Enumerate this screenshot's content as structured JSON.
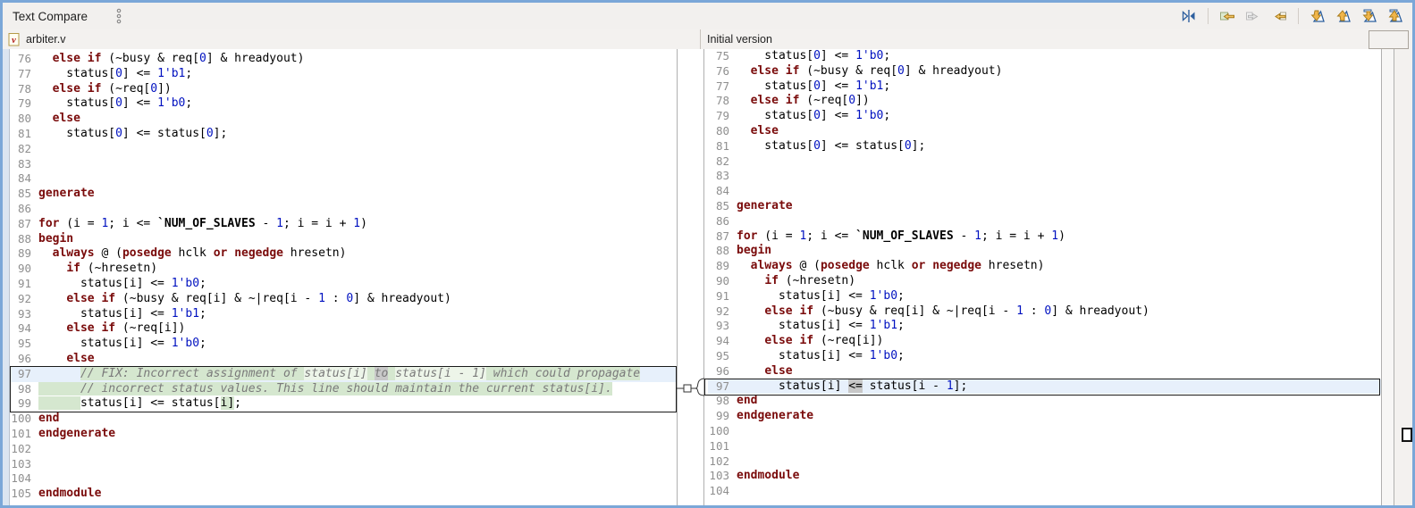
{
  "titlebar": {
    "title": "Text Compare"
  },
  "toolbar": {
    "icons": [
      {
        "name": "swap-left-right-icon"
      },
      {
        "name": "copy-all-right-to-left-icon"
      },
      {
        "name": "copy-left-to-right-icon-disabled"
      },
      {
        "name": "copy-right-to-left-icon"
      },
      {
        "name": "next-difference-icon"
      },
      {
        "name": "previous-difference-icon"
      },
      {
        "name": "next-change-icon"
      },
      {
        "name": "previous-change-icon"
      }
    ]
  },
  "colors": {
    "frame_blue": "#7ba7d8",
    "diff_added_green": "#d5e7cf",
    "selected_line_blue": "#e7f0fb",
    "token_diff_gray": "#c8c8c8",
    "keyword_maroon": "#7a0b0b",
    "literal_blue": "#0011c0"
  },
  "left_pane": {
    "file_name": "arbiter.v",
    "lines": [
      {
        "n": 76,
        "seg": [
          [
            "p",
            "  "
          ],
          [
            "k",
            "else"
          ],
          [
            "p",
            " "
          ],
          [
            "k",
            "if"
          ],
          [
            "p",
            " (~busy & req["
          ],
          [
            "n",
            "0"
          ],
          [
            "p",
            "] & hreadyout)"
          ]
        ]
      },
      {
        "n": 77,
        "seg": [
          [
            "p",
            "    status["
          ],
          [
            "n",
            "0"
          ],
          [
            "p",
            "] <= "
          ],
          [
            "n",
            "1'b1"
          ],
          [
            "p",
            ";"
          ]
        ]
      },
      {
        "n": 78,
        "seg": [
          [
            "p",
            "  "
          ],
          [
            "k",
            "else"
          ],
          [
            "p",
            " "
          ],
          [
            "k",
            "if"
          ],
          [
            "p",
            " (~req["
          ],
          [
            "n",
            "0"
          ],
          [
            "p",
            "])"
          ]
        ]
      },
      {
        "n": 79,
        "seg": [
          [
            "p",
            "    status["
          ],
          [
            "n",
            "0"
          ],
          [
            "p",
            "] <= "
          ],
          [
            "n",
            "1'b0"
          ],
          [
            "p",
            ";"
          ]
        ]
      },
      {
        "n": 80,
        "seg": [
          [
            "p",
            "  "
          ],
          [
            "k",
            "else"
          ]
        ]
      },
      {
        "n": 81,
        "seg": [
          [
            "p",
            "    status["
          ],
          [
            "n",
            "0"
          ],
          [
            "p",
            "] <= status["
          ],
          [
            "n",
            "0"
          ],
          [
            "p",
            "];"
          ]
        ]
      },
      {
        "n": 82,
        "seg": []
      },
      {
        "n": 83,
        "seg": []
      },
      {
        "n": 84,
        "seg": []
      },
      {
        "n": 85,
        "seg": [
          [
            "k",
            "generate"
          ]
        ]
      },
      {
        "n": 86,
        "seg": []
      },
      {
        "n": 87,
        "seg": [
          [
            "k",
            "for"
          ],
          [
            "p",
            " (i = "
          ],
          [
            "n",
            "1"
          ],
          [
            "p",
            "; i <= "
          ],
          [
            "m",
            "`NUM_OF_SLAVES"
          ],
          [
            "p",
            " - "
          ],
          [
            "n",
            "1"
          ],
          [
            "p",
            "; i = i + "
          ],
          [
            "n",
            "1"
          ],
          [
            "p",
            ")"
          ]
        ]
      },
      {
        "n": 88,
        "seg": [
          [
            "k",
            "begin"
          ]
        ]
      },
      {
        "n": 89,
        "seg": [
          [
            "p",
            "  "
          ],
          [
            "k",
            "always"
          ],
          [
            "p",
            " @ ("
          ],
          [
            "k",
            "posedge"
          ],
          [
            "p",
            " hclk "
          ],
          [
            "k",
            "or"
          ],
          [
            "p",
            " "
          ],
          [
            "k",
            "negedge"
          ],
          [
            "p",
            " hresetn)"
          ]
        ]
      },
      {
        "n": 90,
        "seg": [
          [
            "p",
            "    "
          ],
          [
            "k",
            "if"
          ],
          [
            "p",
            " (~hresetn)"
          ]
        ]
      },
      {
        "n": 91,
        "seg": [
          [
            "p",
            "      status[i] <= "
          ],
          [
            "n",
            "1'b0"
          ],
          [
            "p",
            ";"
          ]
        ]
      },
      {
        "n": 92,
        "seg": [
          [
            "p",
            "    "
          ],
          [
            "k",
            "else"
          ],
          [
            "p",
            " "
          ],
          [
            "k",
            "if"
          ],
          [
            "p",
            " (~busy & req[i] & ~|req[i - "
          ],
          [
            "n",
            "1"
          ],
          [
            "p",
            " : "
          ],
          [
            "n",
            "0"
          ],
          [
            "p",
            "] & hreadyout)"
          ]
        ]
      },
      {
        "n": 93,
        "seg": [
          [
            "p",
            "      status[i] <= "
          ],
          [
            "n",
            "1'b1"
          ],
          [
            "p",
            ";"
          ]
        ]
      },
      {
        "n": 94,
        "seg": [
          [
            "p",
            "    "
          ],
          [
            "k",
            "else"
          ],
          [
            "p",
            " "
          ],
          [
            "k",
            "if"
          ],
          [
            "p",
            " (~req[i])"
          ]
        ]
      },
      {
        "n": 95,
        "seg": [
          [
            "p",
            "      status[i] <= "
          ],
          [
            "n",
            "1'b0"
          ],
          [
            "p",
            ";"
          ]
        ]
      },
      {
        "n": 96,
        "seg": [
          [
            "p",
            "    "
          ],
          [
            "k",
            "else"
          ]
        ]
      },
      {
        "n": 97,
        "row": "blue",
        "seg": [
          [
            "p",
            "      "
          ],
          [
            "c",
            "// FIX: Incorrect assignment of ",
            "g"
          ],
          [
            "c",
            "status[i]",
            "gl"
          ],
          [
            "c",
            " ",
            "g"
          ],
          [
            "c",
            "to",
            "gy"
          ],
          [
            "c",
            " ",
            "g"
          ],
          [
            "c",
            "status[i - 1]",
            "gl"
          ],
          [
            "c",
            " which could propagate",
            "g"
          ]
        ]
      },
      {
        "n": 98,
        "seg": [
          [
            "p",
            "      ",
            "g"
          ],
          [
            "c",
            "// incorrect status values. This line should maintain the current status[i].",
            "g"
          ]
        ]
      },
      {
        "n": 99,
        "seg": [
          [
            "p",
            "      ",
            "g"
          ],
          [
            "p",
            "status[i] <= status["
          ],
          [
            "p",
            "i]",
            "g"
          ],
          [
            "p",
            ";"
          ]
        ]
      },
      {
        "n": 100,
        "seg": [
          [
            "k",
            "end"
          ]
        ]
      },
      {
        "n": 101,
        "seg": [
          [
            "k",
            "endgenerate"
          ]
        ]
      },
      {
        "n": 102,
        "seg": []
      },
      {
        "n": 103,
        "seg": []
      },
      {
        "n": 104,
        "seg": []
      },
      {
        "n": 105,
        "seg": [
          [
            "k",
            "endmodule"
          ]
        ]
      }
    ]
  },
  "right_pane": {
    "title": "Initial version",
    "lines": [
      {
        "n": 75,
        "seg": [
          [
            "p",
            "    status["
          ],
          [
            "n",
            "0"
          ],
          [
            "p",
            "] <= "
          ],
          [
            "n",
            "1'b0"
          ],
          [
            "p",
            ";"
          ]
        ]
      },
      {
        "n": 76,
        "seg": [
          [
            "p",
            "  "
          ],
          [
            "k",
            "else"
          ],
          [
            "p",
            " "
          ],
          [
            "k",
            "if"
          ],
          [
            "p",
            " (~busy & req["
          ],
          [
            "n",
            "0"
          ],
          [
            "p",
            "] & hreadyout)"
          ]
        ]
      },
      {
        "n": 77,
        "seg": [
          [
            "p",
            "    status["
          ],
          [
            "n",
            "0"
          ],
          [
            "p",
            "] <= "
          ],
          [
            "n",
            "1'b1"
          ],
          [
            "p",
            ";"
          ]
        ]
      },
      {
        "n": 78,
        "seg": [
          [
            "p",
            "  "
          ],
          [
            "k",
            "else"
          ],
          [
            "p",
            " "
          ],
          [
            "k",
            "if"
          ],
          [
            "p",
            " (~req["
          ],
          [
            "n",
            "0"
          ],
          [
            "p",
            "])"
          ]
        ]
      },
      {
        "n": 79,
        "seg": [
          [
            "p",
            "    status["
          ],
          [
            "n",
            "0"
          ],
          [
            "p",
            "] <= "
          ],
          [
            "n",
            "1'b0"
          ],
          [
            "p",
            ";"
          ]
        ]
      },
      {
        "n": 80,
        "seg": [
          [
            "p",
            "  "
          ],
          [
            "k",
            "else"
          ]
        ]
      },
      {
        "n": 81,
        "seg": [
          [
            "p",
            "    status["
          ],
          [
            "n",
            "0"
          ],
          [
            "p",
            "] <= status["
          ],
          [
            "n",
            "0"
          ],
          [
            "p",
            "];"
          ]
        ]
      },
      {
        "n": 82,
        "seg": []
      },
      {
        "n": 83,
        "seg": []
      },
      {
        "n": 84,
        "seg": []
      },
      {
        "n": 85,
        "seg": [
          [
            "k",
            "generate"
          ]
        ]
      },
      {
        "n": 86,
        "seg": []
      },
      {
        "n": 87,
        "seg": [
          [
            "k",
            "for"
          ],
          [
            "p",
            " (i = "
          ],
          [
            "n",
            "1"
          ],
          [
            "p",
            "; i <= "
          ],
          [
            "m",
            "`NUM_OF_SLAVES"
          ],
          [
            "p",
            " - "
          ],
          [
            "n",
            "1"
          ],
          [
            "p",
            "; i = i + "
          ],
          [
            "n",
            "1"
          ],
          [
            "p",
            ")"
          ]
        ]
      },
      {
        "n": 88,
        "seg": [
          [
            "k",
            "begin"
          ]
        ]
      },
      {
        "n": 89,
        "seg": [
          [
            "p",
            "  "
          ],
          [
            "k",
            "always"
          ],
          [
            "p",
            " @ ("
          ],
          [
            "k",
            "posedge"
          ],
          [
            "p",
            " hclk "
          ],
          [
            "k",
            "or"
          ],
          [
            "p",
            " "
          ],
          [
            "k",
            "negedge"
          ],
          [
            "p",
            " hresetn)"
          ]
        ]
      },
      {
        "n": 90,
        "seg": [
          [
            "p",
            "    "
          ],
          [
            "k",
            "if"
          ],
          [
            "p",
            " (~hresetn)"
          ]
        ]
      },
      {
        "n": 91,
        "seg": [
          [
            "p",
            "      status[i] <= "
          ],
          [
            "n",
            "1'b0"
          ],
          [
            "p",
            ";"
          ]
        ]
      },
      {
        "n": 92,
        "seg": [
          [
            "p",
            "    "
          ],
          [
            "k",
            "else"
          ],
          [
            "p",
            " "
          ],
          [
            "k",
            "if"
          ],
          [
            "p",
            " (~busy & req[i] & ~|req[i - "
          ],
          [
            "n",
            "1"
          ],
          [
            "p",
            " : "
          ],
          [
            "n",
            "0"
          ],
          [
            "p",
            "] & hreadyout)"
          ]
        ]
      },
      {
        "n": 93,
        "seg": [
          [
            "p",
            "      status[i] <= "
          ],
          [
            "n",
            "1'b1"
          ],
          [
            "p",
            ";"
          ]
        ]
      },
      {
        "n": 94,
        "seg": [
          [
            "p",
            "    "
          ],
          [
            "k",
            "else"
          ],
          [
            "p",
            " "
          ],
          [
            "k",
            "if"
          ],
          [
            "p",
            " (~req[i])"
          ]
        ]
      },
      {
        "n": 95,
        "seg": [
          [
            "p",
            "      status[i] <= "
          ],
          [
            "n",
            "1'b0"
          ],
          [
            "p",
            ";"
          ]
        ]
      },
      {
        "n": 96,
        "seg": [
          [
            "p",
            "    "
          ],
          [
            "k",
            "else"
          ]
        ]
      },
      {
        "n": 97,
        "row": "blue",
        "seg": [
          [
            "p",
            "      status[i] "
          ],
          [
            "p",
            "<=",
            "gy"
          ],
          [
            "p",
            " status[i - "
          ],
          [
            "n",
            "1"
          ],
          [
            "p",
            "];"
          ]
        ]
      },
      {
        "n": 98,
        "seg": [
          [
            "k",
            "end"
          ]
        ]
      },
      {
        "n": 99,
        "seg": [
          [
            "k",
            "endgenerate"
          ]
        ]
      },
      {
        "n": 100,
        "seg": []
      },
      {
        "n": 101,
        "seg": []
      },
      {
        "n": 102,
        "seg": []
      },
      {
        "n": 103,
        "seg": [
          [
            "k",
            "endmodule"
          ]
        ]
      },
      {
        "n": 104,
        "seg": []
      }
    ]
  }
}
